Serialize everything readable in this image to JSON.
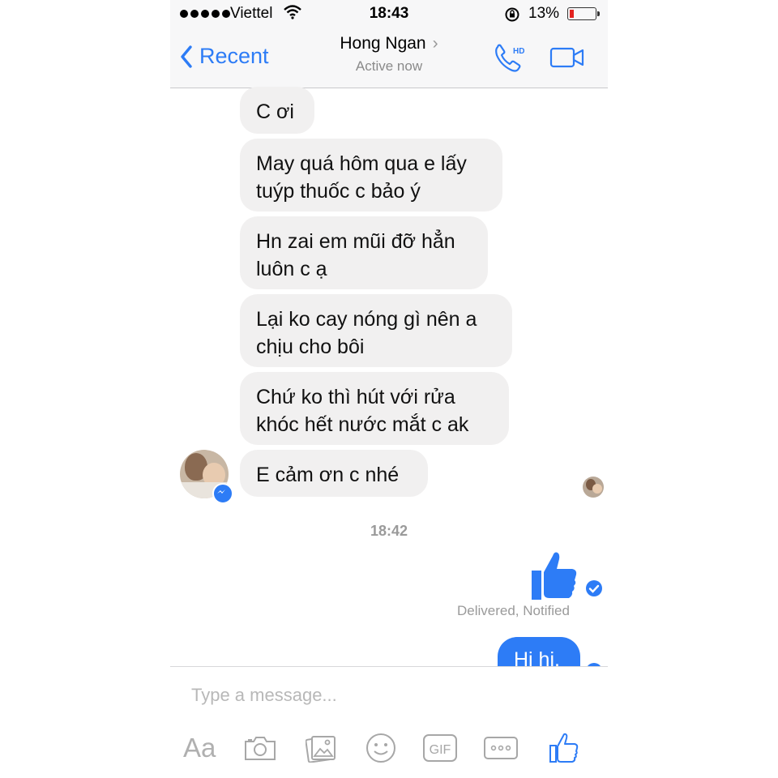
{
  "status_bar": {
    "carrier": "Viettel",
    "time": "18:43",
    "battery_percent": "13%",
    "battery_level": 0.13
  },
  "header": {
    "back_label": "Recent",
    "contact_name": "Hong Ngan",
    "contact_status": "Active now",
    "call_badge": "HD"
  },
  "messages": [
    {
      "text": "C ơi"
    },
    {
      "text": "May quá hôm qua e lấy tuýp thuốc c bảo ý"
    },
    {
      "text": "Hn zai em mũi đỡ hẳn luôn c ạ"
    },
    {
      "text": "Lại ko cay nóng gì nên a chịu cho bôi"
    },
    {
      "text": "Chứ ko thì hút với rửa khóc hết nước mắt c ak"
    },
    {
      "text": "E cảm ơn c nhé"
    }
  ],
  "timestamp": "18:42",
  "sent": {
    "delivered_label": "Delivered, Notified",
    "last_message": "Hi hi."
  },
  "composer": {
    "placeholder": "Type a message...",
    "tools": [
      "Aa",
      "camera-icon",
      "photo-icon",
      "emoji-icon",
      "GIF",
      "more-icon",
      "like-icon"
    ]
  },
  "colors": {
    "accent": "#2d7cf6",
    "incoming_bubble": "#f1f0f0",
    "bar_background": "#f7f7f8",
    "battery_low": "#e3221f"
  }
}
